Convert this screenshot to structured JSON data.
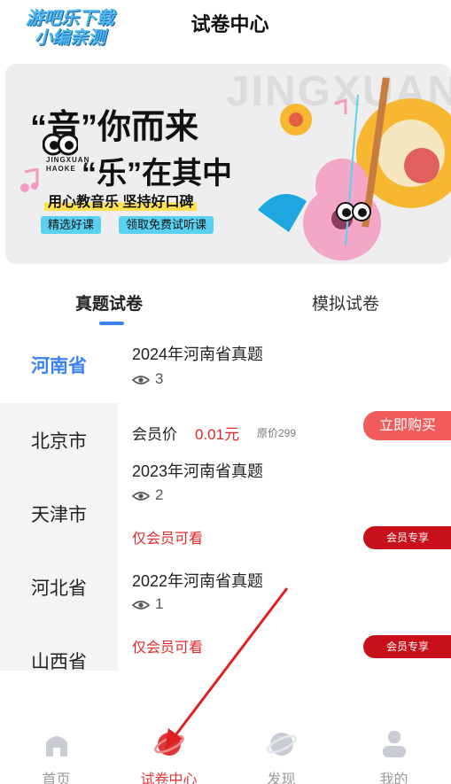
{
  "header": {
    "watermark_line1": "游吧乐下载",
    "watermark_line2": "小编亲测",
    "title": "试卷中心"
  },
  "banner": {
    "background_word": "JINGXUAN",
    "line1": "“音”你而来",
    "line2": "“乐”在其中",
    "brand_line1": "JINGXUAN",
    "brand_line2": "HAOKE",
    "slogan": "用心教音乐 坚持好口碑",
    "tags": [
      "精选好课",
      "领取免费试听课"
    ]
  },
  "tabs": [
    {
      "label": "真题试卷",
      "active": true
    },
    {
      "label": "模拟试卷",
      "active": false
    }
  ],
  "sidebar": {
    "items": [
      {
        "label": "河南省",
        "active": true
      },
      {
        "label": "北京市",
        "active": false
      },
      {
        "label": "天津市",
        "active": false
      },
      {
        "label": "河北省",
        "active": false
      },
      {
        "label": "山西省",
        "active": false
      }
    ]
  },
  "papers": [
    {
      "title": "2024年河南省真题",
      "views": "3"
    },
    {
      "title": "2023年河南省真题",
      "views": "2",
      "access": "仅会员可看",
      "action": "会员专享"
    },
    {
      "title": "2022年河南省真题",
      "views": "1",
      "access": "仅会员可看",
      "action": "会员专享"
    }
  ],
  "membership": {
    "label": "会员价",
    "price": "0.01元",
    "original_price": "原价299",
    "buy_label": "立即购买"
  },
  "bottom_nav": [
    {
      "label": "首页",
      "icon": "home-icon",
      "active": false
    },
    {
      "label": "试卷中心",
      "icon": "exam-center-icon",
      "active": true
    },
    {
      "label": "发现",
      "icon": "discover-icon",
      "active": false
    },
    {
      "label": "我的",
      "icon": "profile-icon",
      "active": false
    }
  ],
  "colors": {
    "accent_blue": "#3b82f6",
    "price_red": "#e02a2a",
    "buy_button": "#f25b5b",
    "vip_button": "#c8101a",
    "nav_active": "#e0363a",
    "annotation_arrow": "#e02020"
  }
}
